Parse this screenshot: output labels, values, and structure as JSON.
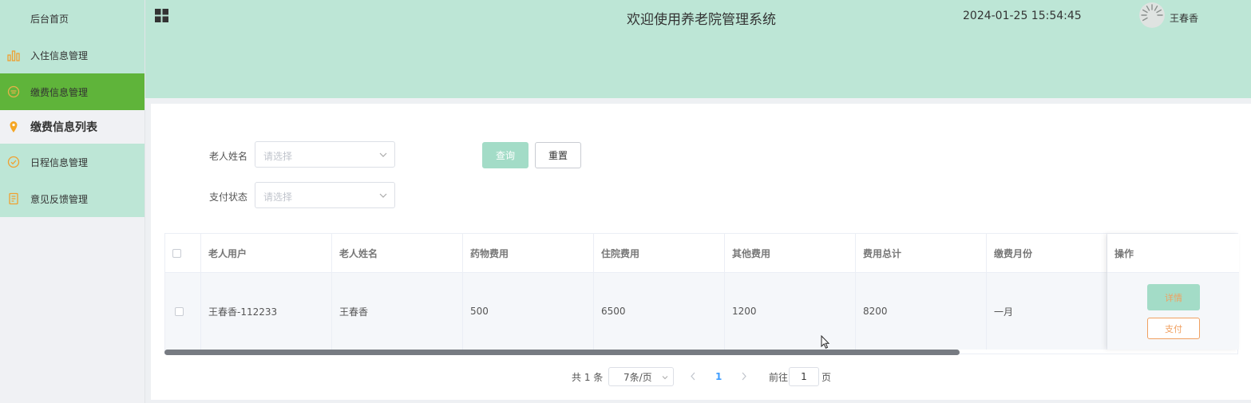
{
  "sidebar": {
    "items": [
      {
        "label": "后台首页"
      },
      {
        "label": "入住信息管理"
      },
      {
        "label": "缴费信息管理"
      },
      {
        "label": "缴费信息列表"
      },
      {
        "label": "日程信息管理"
      },
      {
        "label": "意见反馈管理"
      }
    ]
  },
  "header": {
    "title": "欢迎使用养老院管理系统",
    "datetime": "2024-01-25 15:54:45",
    "username": "王春香"
  },
  "filters": {
    "name_label": "老人姓名",
    "name_placeholder": "请选择",
    "status_label": "支付状态",
    "status_placeholder": "请选择",
    "query_label": "查询",
    "reset_label": "重置"
  },
  "table": {
    "columns": [
      "老人用户",
      "老人姓名",
      "药物费用",
      "住院费用",
      "其他费用",
      "费用总计",
      "缴费月份",
      "操作"
    ],
    "rows": [
      {
        "user": "王春香-112233",
        "name": "王春香",
        "medicine": "500",
        "hospital": "6500",
        "other": "1200",
        "total": "8200",
        "month": "一月"
      }
    ],
    "detail_label": "详情",
    "pay_label": "支付"
  },
  "pagination": {
    "total": "共 1 条",
    "page_size": "7条/页",
    "current_page": "1",
    "goto_prefix": "前往",
    "goto_value": "1",
    "goto_suffix": "页"
  },
  "colors": {
    "header_bg": "#bde6d6",
    "active_menu": "#5fb43a",
    "accent_orange": "#f0a060",
    "page_active": "#409eff"
  }
}
